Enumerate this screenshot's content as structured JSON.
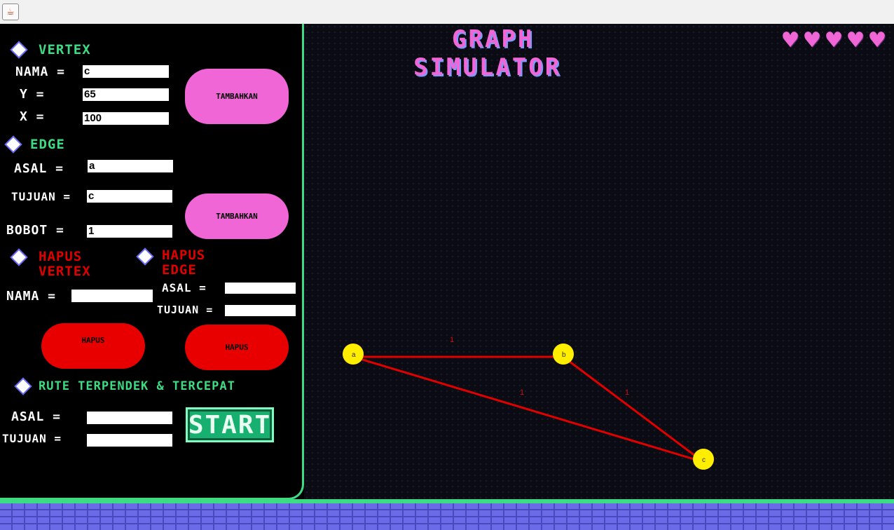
{
  "window": {
    "app_icon": "java-cup-icon"
  },
  "vertex": {
    "heading": "VERTEX",
    "nama_label": "NAMA =",
    "nama_value": "c",
    "y_label": "Y =",
    "y_value": "65",
    "x_label": "X =",
    "x_value": "100",
    "add_button": "TAMBAHKAN"
  },
  "edge": {
    "heading": "EDGE",
    "asal_label": "ASAL =",
    "asal_value": "a",
    "tujuan_label": "TUJUAN =",
    "tujuan_value": "c",
    "bobot_label": "BOBOT =",
    "bobot_value": "1",
    "add_button": "TAMBAHKAN"
  },
  "hapus_vertex": {
    "heading_line1": "HAPUS",
    "heading_line2": "VERTEX",
    "nama_label": "NAMA =",
    "nama_value": "",
    "button": "HAPUS"
  },
  "hapus_edge": {
    "heading_line1": "HAPUS",
    "heading_line2": "EDGE",
    "asal_label": "ASAL =",
    "asal_value": "",
    "tujuan_label": "TUJUAN =",
    "tujuan_value": "",
    "button": "HAPUS"
  },
  "route": {
    "heading": "RUTE TERPENDEK & TERCEPAT",
    "asal_label": "ASAL =",
    "asal_value": "",
    "tujuan_label": "TUJUAN =",
    "tujuan_value": "",
    "start_button": "START"
  },
  "canvas": {
    "title_line1": "GRAPH",
    "title_line2": "SIMULATOR",
    "lives": 5,
    "colors": {
      "vertex": "#ffee00",
      "edge": "#e00000",
      "accent": "#3ddc84",
      "pink": "#f066d6"
    },
    "graph": {
      "vertices": [
        {
          "name": "a"
        },
        {
          "name": "b"
        },
        {
          "name": "c"
        }
      ],
      "edges": [
        {
          "from": "a",
          "to": "b",
          "weight": "1"
        },
        {
          "from": "a",
          "to": "c",
          "weight": "1"
        },
        {
          "from": "b",
          "to": "c",
          "weight": "1"
        }
      ]
    }
  }
}
